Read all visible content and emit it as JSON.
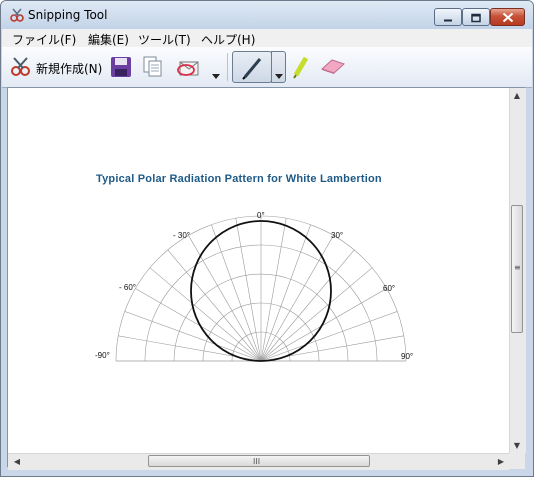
{
  "window": {
    "title": "Snipping Tool"
  },
  "menu": {
    "items": [
      "ファイル(F)",
      "編集(E)",
      "ツール(T)",
      "ヘルプ(H)"
    ]
  },
  "toolbar": {
    "new_label": "新規作成(N)"
  },
  "image": {
    "title": "Typical Polar Radiation Pattern for White Lambertion",
    "angles": {
      "a0": "0°",
      "a30": "30°",
      "a_m30": "- 30°",
      "a60": "60°",
      "a_m60": "- 60°",
      "a90": "90°",
      "a_m90": "-90°"
    }
  },
  "scrollbar": {
    "grip_glyph": "≡",
    "hgrip_glyph": "III",
    "up": "▲",
    "down": "▼",
    "left": "◀",
    "right": "▶"
  }
}
